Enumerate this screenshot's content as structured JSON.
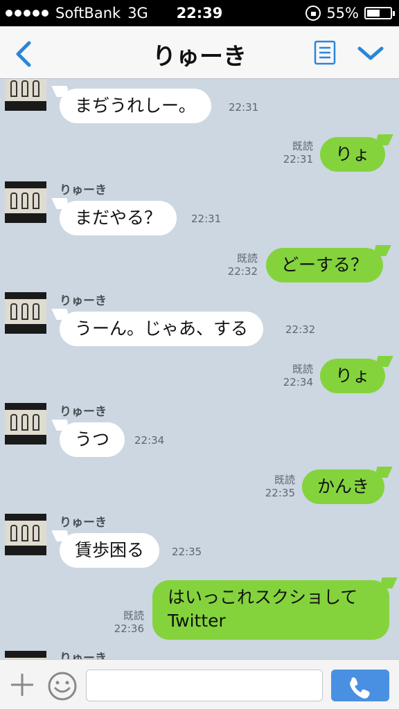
{
  "status": {
    "carrier": "SoftBank",
    "network": "3G",
    "time": "22:39",
    "battery": "55%",
    "battery_level": 0.55
  },
  "nav": {
    "title": "りゅーき",
    "back_icon": "chevron-left-icon",
    "notes_icon": "notes-list-icon",
    "menu_icon": "chevron-down-icon"
  },
  "partner": {
    "name": "りゅーき"
  },
  "messages": [
    {
      "side": "in",
      "text": "まぢうれしー。",
      "time": "22:31"
    },
    {
      "side": "out",
      "text": "りょ",
      "read": "既読",
      "time": "22:31"
    },
    {
      "side": "in",
      "name": "りゅーき",
      "text": "まだやる？",
      "time": "22:31"
    },
    {
      "side": "out",
      "text": "どーする？",
      "read": "既読",
      "time": "22:32"
    },
    {
      "side": "in",
      "name": "りゅーき",
      "text": "うーん。じゃあ、する",
      "time": "22:32"
    },
    {
      "side": "out",
      "text": "りょ",
      "read": "既読",
      "time": "22:34"
    },
    {
      "side": "in",
      "name": "りゅーき",
      "text": "うつ",
      "time": "22:34"
    },
    {
      "side": "out",
      "text": "かんき",
      "read": "既読",
      "time": "22:35"
    },
    {
      "side": "in",
      "name": "りゅーき",
      "text": "賃歩困る",
      "time": "22:35"
    },
    {
      "side": "out",
      "text_line1": "はいっこれスクショして",
      "text_line2": "Twitter",
      "read": "既読",
      "time": "22:36"
    },
    {
      "side": "in",
      "name": "りゅーき"
    }
  ],
  "input": {
    "placeholder": "",
    "plus_icon": "plus-icon",
    "emoji_icon": "emoji-icon",
    "call_icon": "phone-icon"
  },
  "colors": {
    "background": "#ccd7e1",
    "outgoing_bubble": "#84d33d",
    "incoming_bubble": "#ffffff",
    "accent": "#4a90e2"
  }
}
